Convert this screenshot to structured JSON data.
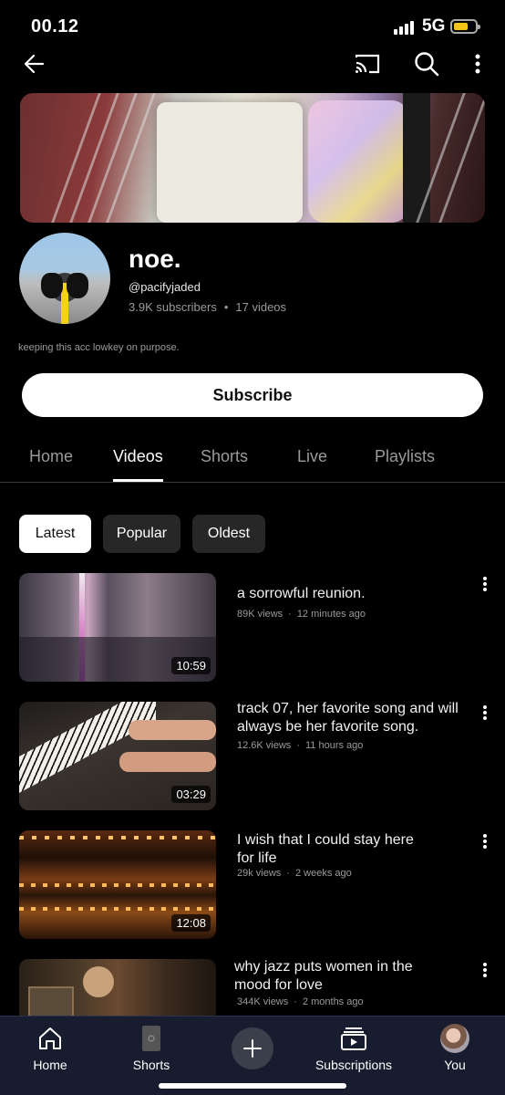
{
  "status_bar": {
    "time": "00.12",
    "network": "5G"
  },
  "channel": {
    "name": "noe.",
    "handle": "@pacifyjaded",
    "subscribers": "3.9K subscribers",
    "video_count": "17 videos",
    "description": "keeping this acc lowkey on purpose."
  },
  "subscribe_label": "Subscribe",
  "tabs": [
    {
      "label": "Home"
    },
    {
      "label": "Videos"
    },
    {
      "label": "Shorts"
    },
    {
      "label": "Live"
    },
    {
      "label": "Playlists"
    }
  ],
  "active_tab": "Videos",
  "chips": [
    {
      "label": "Latest"
    },
    {
      "label": "Popular"
    },
    {
      "label": "Oldest"
    }
  ],
  "videos": [
    {
      "title": "a sorrowful reunion.",
      "views": "89K views",
      "age": "12 minutes ago",
      "duration": "10:59"
    },
    {
      "title": "track 07, her favorite song and will always be her favorite song.",
      "views": "12.6K views",
      "age": "11 hours ago",
      "duration": "03:29"
    },
    {
      "title": "I wish that I could stay here for life",
      "views": "29k views",
      "age": "2 weeks ago",
      "duration": "12:08"
    },
    {
      "title": "why jazz puts women in the mood for love",
      "views": "344K views",
      "age": "2 months ago",
      "duration": ""
    }
  ],
  "bottom_nav": [
    {
      "label": "Home",
      "icon": "home-icon"
    },
    {
      "label": "Shorts",
      "icon": "shorts-icon"
    },
    {
      "label": "",
      "icon": "create-plus-icon"
    },
    {
      "label": "Subscriptions",
      "icon": "subscriptions-icon"
    },
    {
      "label": "You",
      "icon": "profile-avatar-icon"
    }
  ],
  "colors": {
    "background": "#000000",
    "bottom_nav": "#171c2e",
    "battery": "#f5c518",
    "chip": "#272727",
    "secondary_text": "#9a9a9a"
  }
}
